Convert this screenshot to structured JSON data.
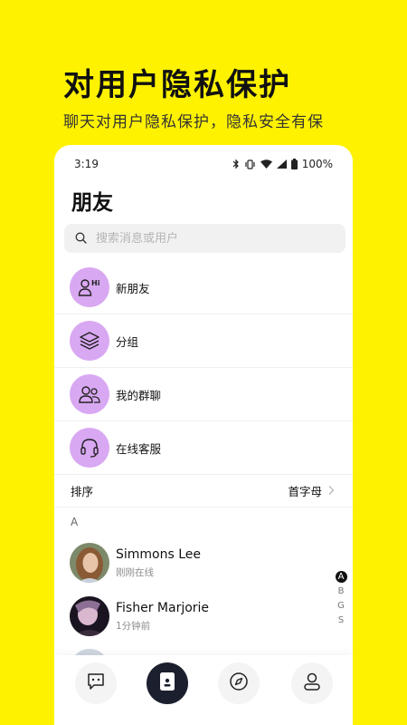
{
  "promo": {
    "headline": "对用户隐私保护",
    "subline": "聊天对用户隐私保护，隐私安全有保"
  },
  "status_bar": {
    "time": "3:19",
    "battery": "100%"
  },
  "page": {
    "title": "朋友"
  },
  "search": {
    "placeholder": "搜索消息或用户"
  },
  "menu": [
    {
      "label": "新朋友",
      "icon": "new-friend-icon"
    },
    {
      "label": "分组",
      "icon": "layers-icon"
    },
    {
      "label": "我的群聊",
      "icon": "group-chat-icon"
    },
    {
      "label": "在线客服",
      "icon": "headset-icon"
    }
  ],
  "sort": {
    "label": "排序",
    "value": "首字母"
  },
  "section_letter": "A",
  "contacts": [
    {
      "name": "Simmons Lee",
      "status": "刚刚在线"
    },
    {
      "name": "Fisher Marjorie",
      "status": "1分钟前"
    }
  ],
  "index_letters": [
    "A",
    "B",
    "G",
    "S"
  ],
  "index_active": "A",
  "tabs": [
    {
      "icon": "chat-bubble-icon",
      "active": false
    },
    {
      "icon": "contacts-card-icon",
      "active": true
    },
    {
      "icon": "compass-icon",
      "active": false
    },
    {
      "icon": "profile-icon",
      "active": false
    }
  ],
  "colors": {
    "background": "#FFF200",
    "menu_circle": "#D9A8F2",
    "active_tab": "#1B1F2E"
  }
}
